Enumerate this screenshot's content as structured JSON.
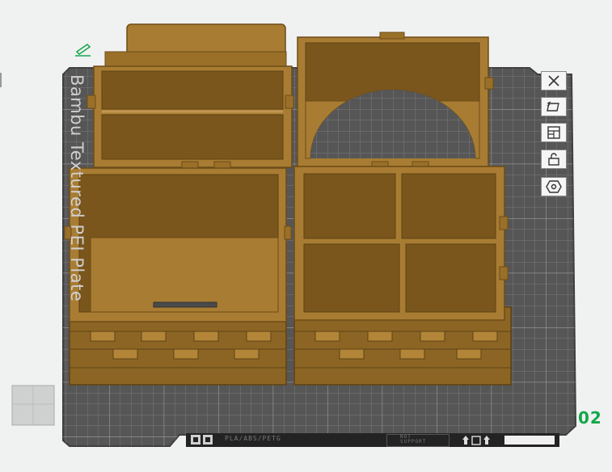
{
  "plate": {
    "label": "Bambu Textured PEI Plate",
    "number": "02",
    "footer_left": "PLA/ABS/PETG",
    "footer_right_line1": "NOT",
    "footer_right_line2": "SUPPORT"
  },
  "toolbar": {
    "items": [
      {
        "name": "close-icon"
      },
      {
        "name": "auto-arrange-icon"
      },
      {
        "name": "layout-icon"
      },
      {
        "name": "lock-icon"
      },
      {
        "name": "settings-hex-icon"
      }
    ]
  },
  "colors": {
    "plate": "#5a5a5a",
    "grid": "#7c7c7c",
    "model": "#a87c32",
    "model_dark": "#7a561c",
    "accent_green": "#12a74a"
  }
}
